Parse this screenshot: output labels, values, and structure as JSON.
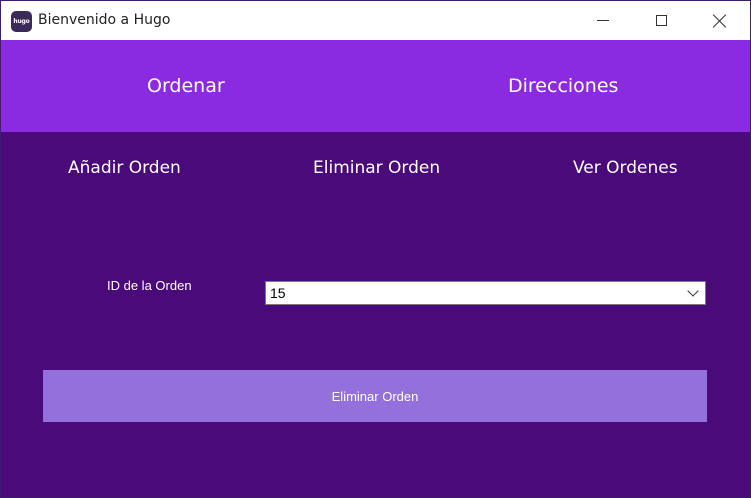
{
  "window": {
    "title": "Bienvenido a Hugo",
    "icon_text": "hugo",
    "icon": "app-logo-icon"
  },
  "window_controls": {
    "minimize_icon": "minimize-icon",
    "maximize_icon": "maximize-icon",
    "close_icon": "close-icon"
  },
  "top_nav": {
    "items": [
      {
        "label": "Ordenar"
      },
      {
        "label": "Direcciones"
      }
    ]
  },
  "sub_nav": {
    "items": [
      {
        "label": "Añadir Orden"
      },
      {
        "label": "Eliminar Orden"
      },
      {
        "label": "Ver Ordenes"
      }
    ]
  },
  "form": {
    "order_id_label": "ID de la Orden",
    "order_id_value": "15",
    "submit_label": "Eliminar Orden"
  },
  "colors": {
    "title_bar": "#ffffff",
    "top_nav_bg": "#8a2be2",
    "content_bg": "#4a0a7a",
    "button_bg": "#9370db",
    "text": "#ffffff"
  }
}
